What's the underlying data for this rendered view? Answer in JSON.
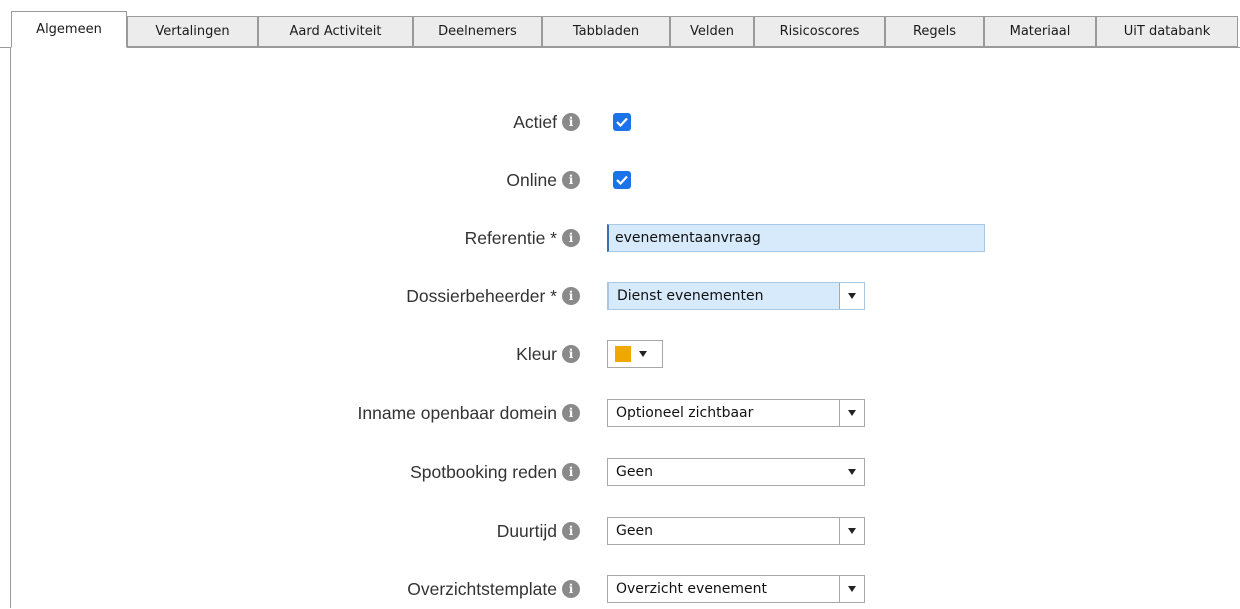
{
  "tabs": [
    {
      "label": "Algemeen",
      "active": true
    },
    {
      "label": "Vertalingen"
    },
    {
      "label": "Aard Activiteit"
    },
    {
      "label": "Deelnemers"
    },
    {
      "label": "Tabbladen"
    },
    {
      "label": "Velden"
    },
    {
      "label": "Risicoscores"
    },
    {
      "label": "Regels"
    },
    {
      "label": "Materiaal"
    },
    {
      "label": "UiT databank"
    }
  ],
  "form": {
    "actief": {
      "label": "Actief",
      "checked": true
    },
    "online": {
      "label": "Online",
      "checked": true
    },
    "referentie": {
      "label": "Referentie *",
      "value": "evenementaanvraag"
    },
    "dossierbeheerder": {
      "label": "Dossierbeheerder *",
      "value": "Dienst evenementen"
    },
    "kleur": {
      "label": "Kleur",
      "color": "#f0a800"
    },
    "inname": {
      "label": "Inname openbaar domein",
      "value": "Optioneel zichtbaar"
    },
    "spotbooking": {
      "label": "Spotbooking reden",
      "value": "Geen"
    },
    "duurtijd": {
      "label": "Duurtijd",
      "value": "Geen"
    },
    "overzicht": {
      "label": "Overzichtstemplate",
      "value": "Overzicht evenement"
    }
  },
  "icons": {
    "info": "info-icon",
    "checkmark": "check-icon",
    "dropdown": "chevron-down-icon"
  },
  "colors": {
    "checkbox": "#1a73e8",
    "focus_bg": "#d6eafb"
  }
}
